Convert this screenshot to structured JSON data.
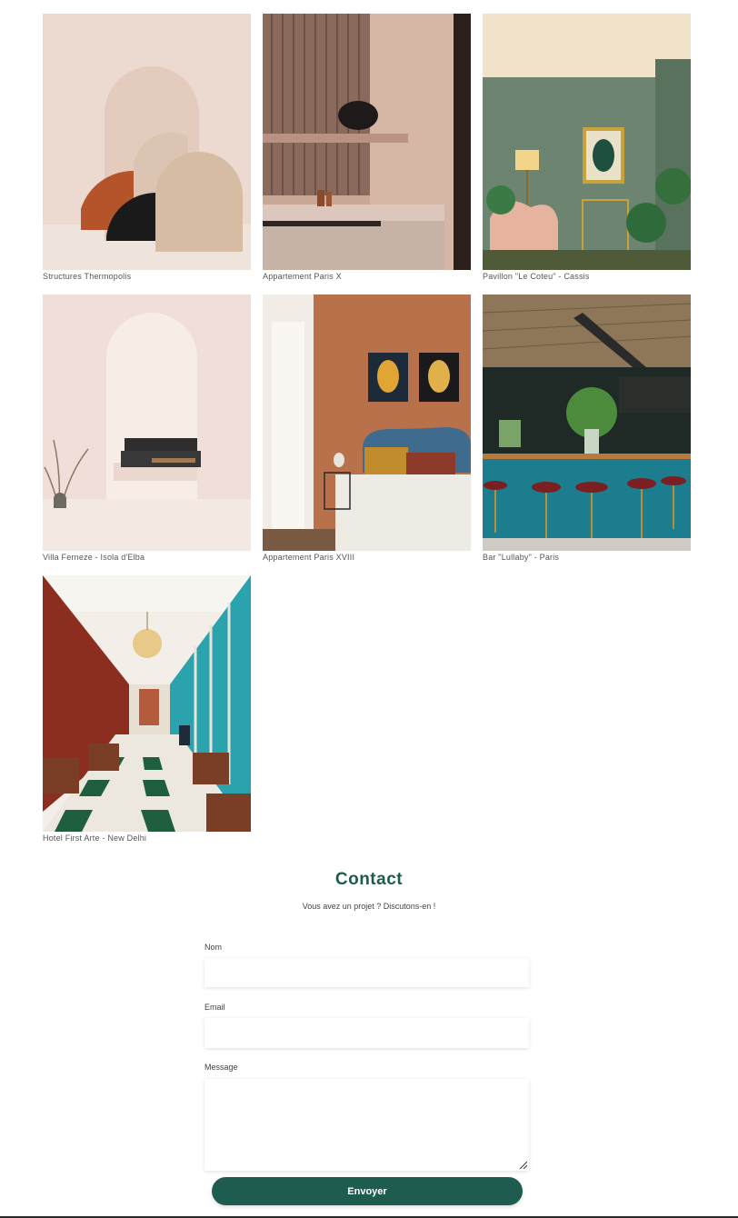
{
  "projects": [
    {
      "caption": "Structures Thermopolis"
    },
    {
      "caption": "Appartement Paris X"
    },
    {
      "caption": "Pavillon \"Le Coteu\" - Cassis"
    },
    {
      "caption": "Villa Ferneze - Isola d'Elba"
    },
    {
      "caption": "Appartement Paris XVIII"
    },
    {
      "caption": "Bar \"Lullaby\" - Paris"
    },
    {
      "caption": "Hotel First Arte - New Delhi"
    }
  ],
  "contact": {
    "title": "Contact",
    "subtitle": "Vous avez un projet ? Discutons-en !",
    "name_label": "Nom",
    "email_label": "Email",
    "message_label": "Message",
    "submit_label": "Envoyer"
  },
  "colors": {
    "accent": "#1e5c4f"
  }
}
